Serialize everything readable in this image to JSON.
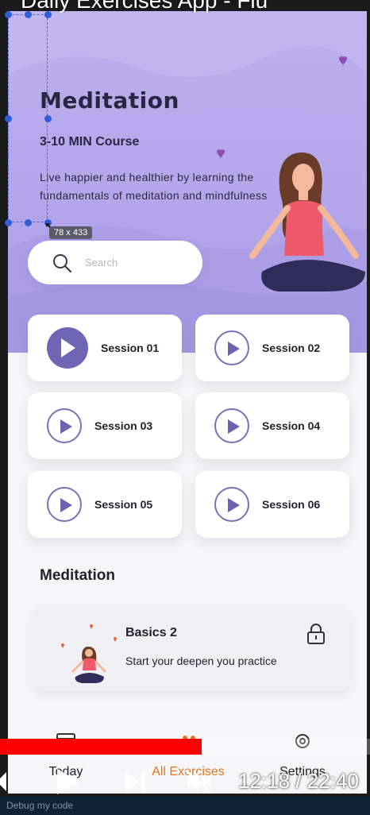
{
  "video": {
    "title": "Daily Exercises App - Flu",
    "time": "12:18 / 22:40",
    "progress_fraction": 0.545
  },
  "header": {
    "title": "Meditation",
    "subtitle": "3-10 MIN Course",
    "description": "Live happier and healthier by learning the fundamentals of meditation and mindfulness"
  },
  "search": {
    "placeholder": "Search"
  },
  "sessions": [
    {
      "label": "Session 01",
      "active": true
    },
    {
      "label": "Session 02",
      "active": false
    },
    {
      "label": "Session 03",
      "active": false
    },
    {
      "label": "Session 04",
      "active": false
    },
    {
      "label": "Session 05",
      "active": false
    },
    {
      "label": "Session 06",
      "active": false
    }
  ],
  "section": {
    "title": "Meditation"
  },
  "course": {
    "title": "Basics 2",
    "subtitle": "Start your deepen you practice",
    "icon": "lock-icon"
  },
  "nav": [
    {
      "label": "Today",
      "icon": "calendar-icon",
      "active": false
    },
    {
      "label": "All Exercises",
      "icon": "exercise-icon",
      "active": true
    },
    {
      "label": "Settings",
      "icon": "gear-icon",
      "active": false
    }
  ],
  "editor": {
    "size_tip": "78 x 433"
  },
  "ide": {
    "debug_label": "Debug my code"
  },
  "colors": {
    "hero": "#b3a5ea",
    "accent": "#7065b4",
    "active_nav": "#e0781f",
    "progress": "#ff0000"
  }
}
